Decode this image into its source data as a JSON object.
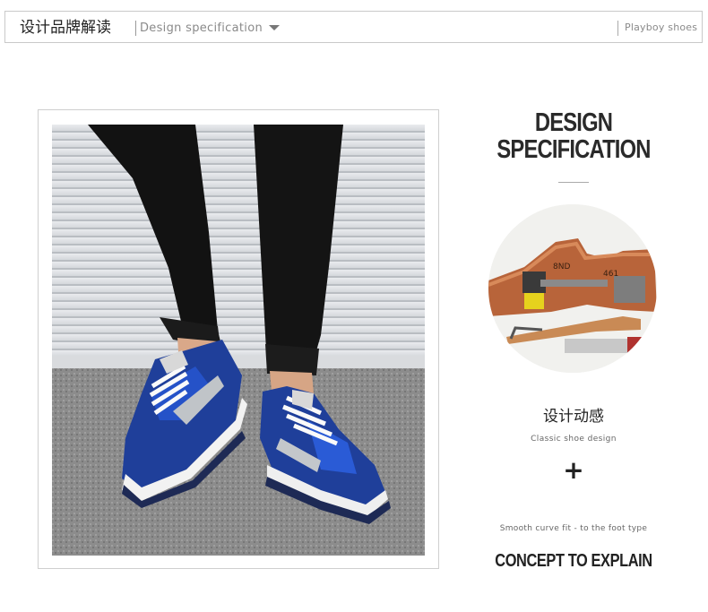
{
  "header": {
    "title_cn": "设计品牌解读",
    "subtitle_en": "Design specification",
    "brand": "Playboy shoes",
    "dropdown_icon": "triangle-down-icon"
  },
  "photo": {
    "description_icon": "sneaker-photo"
  },
  "right": {
    "title_line1": "DESIGN",
    "title_line2": "SPECIFICATION",
    "tools_image_icon": "shoemaking-tools-image",
    "subtitle_cn": "设计动感",
    "subtitle_en": "Classic shoe design",
    "plus": "+",
    "fit_text": "Smooth curve fit - to the foot type",
    "concept": "CONCEPT TO EXPLAIN"
  },
  "colors": {
    "shoe_blue": "#1f3f9a",
    "frame_border": "#cfcfcf",
    "header_border": "#c9c9c9"
  }
}
